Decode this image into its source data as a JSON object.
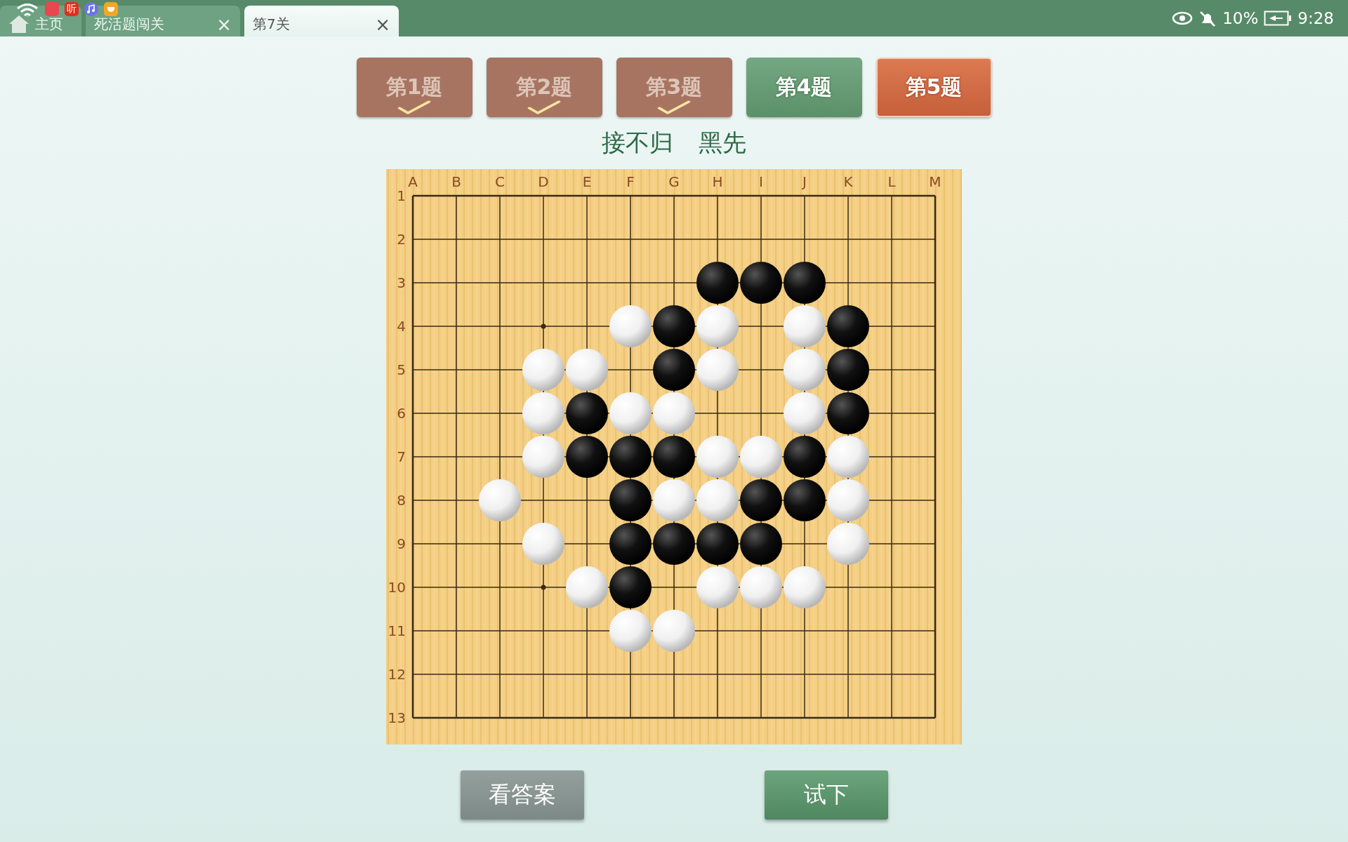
{
  "tabs": [
    {
      "kind": "home",
      "label": "主页",
      "selected": false
    },
    {
      "kind": "page",
      "label": "死活题闯关",
      "close": "×",
      "selected": false
    },
    {
      "kind": "page",
      "label": "第7关",
      "close": "×",
      "selected": true
    }
  ],
  "notifications": [
    {
      "kind": "store"
    },
    {
      "kind": "text",
      "label": "听"
    },
    {
      "kind": "music"
    },
    {
      "kind": "cup"
    }
  ],
  "status_bar": {
    "battery": "10%",
    "time": "9:28"
  },
  "problems": [
    {
      "label": "第1题",
      "solved": true,
      "selected": false
    },
    {
      "label": "第2题",
      "solved": true,
      "selected": false
    },
    {
      "label": "第3题",
      "solved": true,
      "selected": false
    },
    {
      "label": "第4题",
      "solved": false,
      "selected": false
    },
    {
      "label": "第5题",
      "solved": false,
      "selected": true
    }
  ],
  "heading": {
    "title": "接不归",
    "to_play": "黑先"
  },
  "board": {
    "columns": [
      "A",
      "B",
      "C",
      "D",
      "E",
      "F",
      "G",
      "H",
      "I",
      "J",
      "K",
      "L",
      "M"
    ],
    "row_labels": [
      "1",
      "2",
      "3",
      "4",
      "5",
      "6",
      "7",
      "8",
      "9",
      "10",
      "11",
      "12",
      "13"
    ],
    "grid": [
      {
        "points": [
          {
            "kind": "empty"
          },
          {
            "kind": "empty"
          },
          {
            "kind": "empty"
          },
          {
            "kind": "empty"
          },
          {
            "kind": "empty"
          },
          {
            "kind": "empty"
          },
          {
            "kind": "empty"
          },
          {
            "kind": "empty"
          },
          {
            "kind": "empty"
          },
          {
            "kind": "empty"
          },
          {
            "kind": "empty"
          },
          {
            "kind": "empty"
          },
          {
            "kind": "empty"
          }
        ]
      },
      {
        "points": [
          {
            "kind": "empty"
          },
          {
            "kind": "empty"
          },
          {
            "kind": "empty"
          },
          {
            "kind": "empty"
          },
          {
            "kind": "empty"
          },
          {
            "kind": "empty"
          },
          {
            "kind": "empty"
          },
          {
            "kind": "empty"
          },
          {
            "kind": "empty"
          },
          {
            "kind": "empty"
          },
          {
            "kind": "empty"
          },
          {
            "kind": "empty"
          },
          {
            "kind": "empty"
          }
        ]
      },
      {
        "points": [
          {
            "kind": "empty"
          },
          {
            "kind": "empty"
          },
          {
            "kind": "empty"
          },
          {
            "kind": "empty"
          },
          {
            "kind": "empty"
          },
          {
            "kind": "empty"
          },
          {
            "kind": "empty"
          },
          {
            "kind": "black"
          },
          {
            "kind": "black"
          },
          {
            "kind": "black"
          },
          {
            "kind": "empty"
          },
          {
            "kind": "empty"
          },
          {
            "kind": "empty"
          }
        ]
      },
      {
        "points": [
          {
            "kind": "empty"
          },
          {
            "kind": "empty"
          },
          {
            "kind": "empty"
          },
          {
            "kind": "empty"
          },
          {
            "kind": "empty"
          },
          {
            "kind": "white"
          },
          {
            "kind": "black"
          },
          {
            "kind": "white"
          },
          {
            "kind": "empty"
          },
          {
            "kind": "white"
          },
          {
            "kind": "black"
          },
          {
            "kind": "empty"
          },
          {
            "kind": "empty"
          }
        ]
      },
      {
        "points": [
          {
            "kind": "empty"
          },
          {
            "kind": "empty"
          },
          {
            "kind": "empty"
          },
          {
            "kind": "white"
          },
          {
            "kind": "white"
          },
          {
            "kind": "empty"
          },
          {
            "kind": "black"
          },
          {
            "kind": "white"
          },
          {
            "kind": "empty"
          },
          {
            "kind": "white"
          },
          {
            "kind": "black"
          },
          {
            "kind": "empty"
          },
          {
            "kind": "empty"
          }
        ]
      },
      {
        "points": [
          {
            "kind": "empty"
          },
          {
            "kind": "empty"
          },
          {
            "kind": "empty"
          },
          {
            "kind": "white"
          },
          {
            "kind": "black"
          },
          {
            "kind": "white"
          },
          {
            "kind": "white"
          },
          {
            "kind": "empty"
          },
          {
            "kind": "empty"
          },
          {
            "kind": "white"
          },
          {
            "kind": "black"
          },
          {
            "kind": "empty"
          },
          {
            "kind": "empty"
          }
        ]
      },
      {
        "points": [
          {
            "kind": "empty"
          },
          {
            "kind": "empty"
          },
          {
            "kind": "empty"
          },
          {
            "kind": "white"
          },
          {
            "kind": "black"
          },
          {
            "kind": "black"
          },
          {
            "kind": "black"
          },
          {
            "kind": "white"
          },
          {
            "kind": "white"
          },
          {
            "kind": "black"
          },
          {
            "kind": "white"
          },
          {
            "kind": "empty"
          },
          {
            "kind": "empty"
          }
        ]
      },
      {
        "points": [
          {
            "kind": "empty"
          },
          {
            "kind": "empty"
          },
          {
            "kind": "white"
          },
          {
            "kind": "empty"
          },
          {
            "kind": "empty"
          },
          {
            "kind": "black"
          },
          {
            "kind": "white"
          },
          {
            "kind": "white"
          },
          {
            "kind": "black"
          },
          {
            "kind": "black"
          },
          {
            "kind": "white"
          },
          {
            "kind": "empty"
          },
          {
            "kind": "empty"
          }
        ]
      },
      {
        "points": [
          {
            "kind": "empty"
          },
          {
            "kind": "empty"
          },
          {
            "kind": "empty"
          },
          {
            "kind": "white"
          },
          {
            "kind": "empty"
          },
          {
            "kind": "black"
          },
          {
            "kind": "black"
          },
          {
            "kind": "black"
          },
          {
            "kind": "black"
          },
          {
            "kind": "empty"
          },
          {
            "kind": "white"
          },
          {
            "kind": "empty"
          },
          {
            "kind": "empty"
          }
        ]
      },
      {
        "points": [
          {
            "kind": "empty"
          },
          {
            "kind": "empty"
          },
          {
            "kind": "empty"
          },
          {
            "kind": "empty"
          },
          {
            "kind": "white"
          },
          {
            "kind": "black"
          },
          {
            "kind": "empty"
          },
          {
            "kind": "white"
          },
          {
            "kind": "white"
          },
          {
            "kind": "white"
          },
          {
            "kind": "empty"
          },
          {
            "kind": "empty"
          },
          {
            "kind": "empty"
          }
        ]
      },
      {
        "points": [
          {
            "kind": "empty"
          },
          {
            "kind": "empty"
          },
          {
            "kind": "empty"
          },
          {
            "kind": "empty"
          },
          {
            "kind": "empty"
          },
          {
            "kind": "white"
          },
          {
            "kind": "white"
          },
          {
            "kind": "empty"
          },
          {
            "kind": "empty"
          },
          {
            "kind": "empty"
          },
          {
            "kind": "empty"
          },
          {
            "kind": "empty"
          },
          {
            "kind": "empty"
          }
        ]
      },
      {
        "points": [
          {
            "kind": "empty"
          },
          {
            "kind": "empty"
          },
          {
            "kind": "empty"
          },
          {
            "kind": "empty"
          },
          {
            "kind": "empty"
          },
          {
            "kind": "empty"
          },
          {
            "kind": "empty"
          },
          {
            "kind": "empty"
          },
          {
            "kind": "empty"
          },
          {
            "kind": "empty"
          },
          {
            "kind": "empty"
          },
          {
            "kind": "empty"
          },
          {
            "kind": "empty"
          }
        ]
      },
      {
        "points": [
          {
            "kind": "empty"
          },
          {
            "kind": "empty"
          },
          {
            "kind": "empty"
          },
          {
            "kind": "empty"
          },
          {
            "kind": "empty"
          },
          {
            "kind": "empty"
          },
          {
            "kind": "empty"
          },
          {
            "kind": "empty"
          },
          {
            "kind": "empty"
          },
          {
            "kind": "empty"
          },
          {
            "kind": "empty"
          },
          {
            "kind": "empty"
          },
          {
            "kind": "empty"
          }
        ]
      }
    ]
  },
  "actions": [
    {
      "kind": "secondary",
      "label": "看答案"
    },
    {
      "kind": "primary",
      "label": "试下"
    }
  ]
}
